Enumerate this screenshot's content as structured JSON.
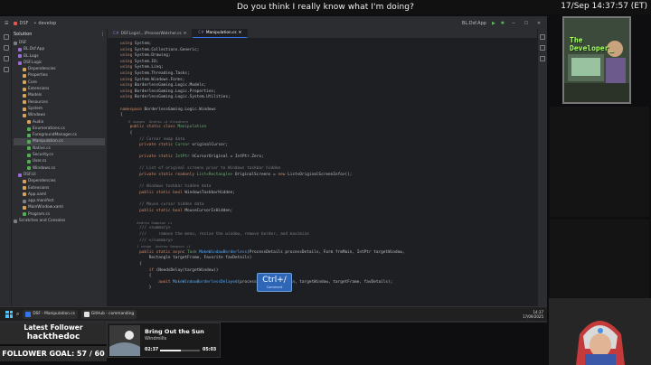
{
  "stream": {
    "title": "Do you think I really know what I'm doing?",
    "datetime": "17/Sep 14:37:57 (ET)"
  },
  "ide": {
    "titlebar": {
      "project": "DSF",
      "branch": "develop",
      "run_config": "BL.Dsf.App"
    },
    "solution_header": "Solution",
    "tree": [
      {
        "label": "DSF",
        "indent": 0,
        "color": "#7a7e85"
      },
      {
        "label": "BL.Dsf.App",
        "indent": 1,
        "color": "#9b6bd8"
      },
      {
        "label": "BL.Logs",
        "indent": 1,
        "color": "#9b6bd8"
      },
      {
        "label": "DSF.Logic",
        "indent": 1,
        "color": "#9b6bd8"
      },
      {
        "label": "Dependencies",
        "indent": 2,
        "color": "#d8a25b"
      },
      {
        "label": "Properties",
        "indent": 2,
        "color": "#d8a25b"
      },
      {
        "label": "Core",
        "indent": 2,
        "color": "#d8a25b"
      },
      {
        "label": "Extensions",
        "indent": 2,
        "color": "#d8a25b"
      },
      {
        "label": "Models",
        "indent": 2,
        "color": "#d8a25b"
      },
      {
        "label": "Resources",
        "indent": 2,
        "color": "#d8a25b"
      },
      {
        "label": "System",
        "indent": 2,
        "color": "#d8a25b"
      },
      {
        "label": "Windows",
        "indent": 2,
        "color": "#d8a25b"
      },
      {
        "label": "Audio",
        "indent": 3,
        "color": "#d8a25b"
      },
      {
        "label": "Enumerations.cs",
        "indent": 3,
        "color": "#4fb04f"
      },
      {
        "label": "ForegroundManager.cs",
        "indent": 3,
        "color": "#4fb04f"
      },
      {
        "label": "Manipulation.cs",
        "indent": 3,
        "color": "#4fb04f",
        "selected": true
      },
      {
        "label": "Native.cs",
        "indent": 3,
        "color": "#4fb04f"
      },
      {
        "label": "Security.cs",
        "indent": 3,
        "color": "#4fb04f"
      },
      {
        "label": "User.cs",
        "indent": 3,
        "color": "#4fb04f"
      },
      {
        "label": "Windows.cs",
        "indent": 3,
        "color": "#4fb04f"
      },
      {
        "label": "DSF.UI",
        "indent": 1,
        "color": "#9b6bd8"
      },
      {
        "label": "Dependencies",
        "indent": 2,
        "color": "#d8a25b"
      },
      {
        "label": "Extensions",
        "indent": 2,
        "color": "#d8a25b"
      },
      {
        "label": "App.xaml",
        "indent": 2,
        "color": "#d8a25b"
      },
      {
        "label": "app.manifest",
        "indent": 2,
        "color": "#7a7e85"
      },
      {
        "label": "MainWindow.xaml",
        "indent": 2,
        "color": "#d8a25b"
      },
      {
        "label": "Program.cs",
        "indent": 2,
        "color": "#4fb04f"
      },
      {
        "label": "Scratches and Consoles",
        "indent": 0,
        "color": "#7a7e85"
      }
    ],
    "tabs": [
      {
        "label": "DSF.Logic\\...\\ProcessWatcher.cs",
        "active": false
      },
      {
        "label": "Manipulation.cs",
        "active": true
      }
    ],
    "code": [
      [
        {
          "c": "kw",
          "t": "using "
        },
        {
          "c": "nm",
          "t": "System;"
        }
      ],
      [
        {
          "c": "kw",
          "t": "using "
        },
        {
          "c": "nm",
          "t": "System.Collections.Generic;"
        }
      ],
      [
        {
          "c": "kw",
          "t": "using "
        },
        {
          "c": "nm",
          "t": "System.Drawing;"
        }
      ],
      [
        {
          "c": "kw",
          "t": "using "
        },
        {
          "c": "nm",
          "t": "System.IO;"
        }
      ],
      [
        {
          "c": "kw",
          "t": "using "
        },
        {
          "c": "nm",
          "t": "System.Linq;"
        }
      ],
      [
        {
          "c": "kw",
          "t": "using "
        },
        {
          "c": "nm",
          "t": "System.Threading.Tasks;"
        }
      ],
      [
        {
          "c": "kw",
          "t": "using "
        },
        {
          "c": "nm",
          "t": "System.Windows.Forms;"
        }
      ],
      [
        {
          "c": "kw",
          "t": "using "
        },
        {
          "c": "nm",
          "t": "BorderlessGaming.Logic.Models;"
        }
      ],
      [
        {
          "c": "kw",
          "t": "using "
        },
        {
          "c": "nm",
          "t": "BorderlessGaming.Logic.Properties;"
        }
      ],
      [
        {
          "c": "kw",
          "t": "using "
        },
        {
          "c": "nm",
          "t": "BorderlessGaming.Logic.System.Utilities;"
        }
      ],
      [
        {
          "c": "nm",
          "t": ""
        }
      ],
      [
        {
          "c": "kw",
          "t": "namespace "
        },
        {
          "c": "nm",
          "t": "BorderlessGaming.Logic.Windows"
        }
      ],
      [
        {
          "c": "nm",
          "t": "{"
        }
      ],
      [
        {
          "c": "hint",
          "t": "    6 usages  Andrew +4 elsewhere"
        }
      ],
      [
        {
          "c": "kw",
          "t": "    public static class "
        },
        {
          "c": "ty",
          "t": "Manipulation"
        }
      ],
      [
        {
          "c": "nm",
          "t": "    {"
        }
      ],
      [
        {
          "c": "cm",
          "t": "        // Cursor swap data"
        }
      ],
      [
        {
          "c": "kw",
          "t": "        private static "
        },
        {
          "c": "ty",
          "t": "Cursor "
        },
        {
          "c": "nm",
          "t": "originalCursor;"
        }
      ],
      [
        {
          "c": "nm",
          "t": ""
        }
      ],
      [
        {
          "c": "kw",
          "t": "        private static "
        },
        {
          "c": "ty",
          "t": "IntPtr "
        },
        {
          "c": "nm",
          "t": "hCursorOriginal = IntPtr.Zero;"
        }
      ],
      [
        {
          "c": "nm",
          "t": ""
        }
      ],
      [
        {
          "c": "cm",
          "t": "        // List of original screens prior to Windows taskbar hidden"
        }
      ],
      [
        {
          "c": "kw",
          "t": "        private static readonly "
        },
        {
          "c": "ty",
          "t": "List<Rectangle> "
        },
        {
          "c": "nm",
          "t": "OriginalScreens = "
        },
        {
          "c": "kw",
          "t": "new "
        },
        {
          "c": "nm",
          "t": "List<OriginalScreenInfo>();"
        }
      ],
      [
        {
          "c": "nm",
          "t": ""
        }
      ],
      [
        {
          "c": "cm",
          "t": "        // Windows taskbar hidden data"
        }
      ],
      [
        {
          "c": "kw",
          "t": "        public static bool "
        },
        {
          "c": "nm",
          "t": "WindowsTaskbarHidden;"
        }
      ],
      [
        {
          "c": "nm",
          "t": ""
        }
      ],
      [
        {
          "c": "cm",
          "t": "        // Mouse cursor hidden data"
        }
      ],
      [
        {
          "c": "kw",
          "t": "        public static bool "
        },
        {
          "c": "nm",
          "t": "MouseCursorIsHidden;"
        }
      ],
      [
        {
          "c": "nm",
          "t": ""
        }
      ],
      [
        {
          "c": "hint",
          "t": "        Andrew Sampson +1"
        }
      ],
      [
        {
          "c": "cm",
          "t": "        /// <summary>"
        }
      ],
      [
        {
          "c": "cm",
          "t": "        ///     remove the menu, resize the window, remove border, and maximize"
        }
      ],
      [
        {
          "c": "cm",
          "t": "        /// </summary>"
        }
      ],
      [
        {
          "c": "hint",
          "t": "        1 usage  Andrew Sampson +1"
        }
      ],
      [
        {
          "c": "kw",
          "t": "        public static async "
        },
        {
          "c": "ty",
          "t": "Task "
        },
        {
          "c": "fn",
          "t": "MakeWindowBorderless"
        },
        {
          "c": "nm",
          "t": "(ProcessDetails processDetails, Form frmMain, IntPtr targetWindow,"
        }
      ],
      [
        {
          "c": "nm",
          "t": "            Rectangle targetFrame, Favorite favDetails)"
        }
      ],
      [
        {
          "c": "nm",
          "t": "        {"
        }
      ],
      [
        {
          "c": "kw",
          "t": "            if "
        },
        {
          "c": "nm",
          "t": "(NeedsDelay(targetWindow))"
        }
      ],
      [
        {
          "c": "nm",
          "t": "            {"
        }
      ],
      [
        {
          "c": "kw",
          "t": "                await "
        },
        {
          "c": "fn",
          "t": "MakeWindowBorderlessDelayed"
        },
        {
          "c": "nm",
          "t": "(processDetails, frmMain, targetWindow, targetFrame, favDetails);"
        }
      ],
      [
        {
          "c": "nm",
          "t": "            }"
        }
      ]
    ],
    "statusbar": {
      "left": "DSF > DSF.Logic > Windows > C# Manipulation.cs",
      "items": [
        "Windsurf",
        "7:28",
        "CRLF",
        "UTF-8",
        "10 errors in 2 files",
        "4 spaces"
      ]
    }
  },
  "key_overlay": {
    "keys": "Ctrl+/",
    "action": "Comment"
  },
  "taskbar": {
    "apps": [
      {
        "label": "DSF - Manipulation.cs",
        "color": "#3574f0"
      },
      {
        "label": "GitHub - commanding",
        "color": "#e0e0e0"
      }
    ],
    "clock_time": "14:37",
    "clock_date": "17/09/2025"
  },
  "overlay": {
    "webcam_text_line1": "The",
    "webcam_text_line2": "Developer_",
    "latest_follower_label": "Latest Follower",
    "latest_follower_name": "hackthedoc",
    "follower_goal": "FOLLOWER GOAL: 57 / 60"
  },
  "now_playing": {
    "title": "Bring Out the Sun",
    "artist": "Windmills",
    "time_current": "02:37",
    "time_total": "05:03",
    "progress": 0.52
  }
}
